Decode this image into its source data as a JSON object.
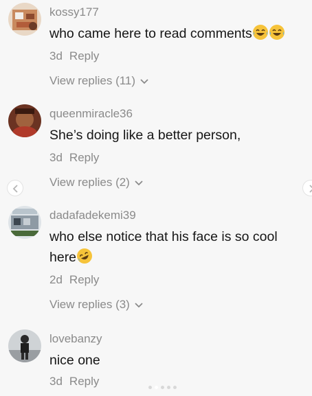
{
  "comments": [
    {
      "username": "kossy177",
      "text": "who came here to read comments",
      "time": "3d",
      "reply_label": "Reply",
      "view_replies": "View replies (11)",
      "text_emojis": [
        "laughing-tears-emoji",
        "laughing-tears-emoji"
      ]
    },
    {
      "username": "queenmiracle36",
      "text": "She’s doing like a better person,",
      "time": "3d",
      "reply_label": "Reply",
      "view_replies": "View replies (2)"
    },
    {
      "username": "dadafadekemi39",
      "text": "who else notice that his face is so cool",
      "text_line2": "here",
      "time": "2d",
      "reply_label": "Reply",
      "view_replies": "View replies (3)",
      "text_emojis": [
        "rofl-emoji"
      ]
    },
    {
      "username": "lovebanzy",
      "text": "nice one",
      "time": "3d",
      "reply_label": "Reply"
    }
  ],
  "carousel": {
    "prev_icon": "chevron-left-icon",
    "next_icon": "chevron-right-icon",
    "dot_count": 5,
    "active_dot": 1
  },
  "colors": {
    "background": "#f7f7f7",
    "text_primary": "#161616",
    "text_secondary": "#8a8a8a",
    "emoji_yellow": "#f6c33a"
  }
}
